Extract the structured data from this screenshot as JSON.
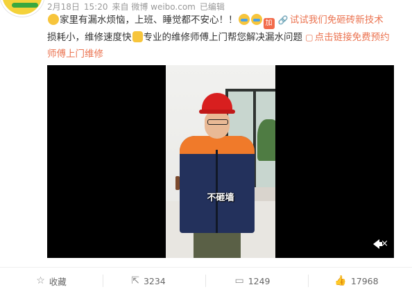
{
  "post": {
    "date": "2月18日",
    "time": "15:20",
    "source": "来自 微博 weibo.com",
    "edited": "已编辑",
    "text_a": "家里有漏水烦恼，上班、睡觉都不安心！！",
    "jia": "加",
    "link1_text": "试试我们免砸砖新技术",
    "text_b": "损耗小，维修速度快",
    "text_c": "专业的维修师傅上门帮您解决漏水问题",
    "link2_text": "点击链接免费预约师傅上门维修"
  },
  "video": {
    "caption": "不砸墙",
    "mute_symbol": "×"
  },
  "actions": {
    "favorite_label": "收藏",
    "repost_count": "3234",
    "comment_count": "1249",
    "like_count": "17968"
  },
  "icons": {
    "favorite": "star-icon",
    "repost": "share-icon",
    "comment": "comment-icon",
    "like": "thumbs-up-icon",
    "mute": "speaker-muted-icon"
  },
  "colors": {
    "link": "#eb7350",
    "meta": "#999999",
    "text": "#333333"
  }
}
